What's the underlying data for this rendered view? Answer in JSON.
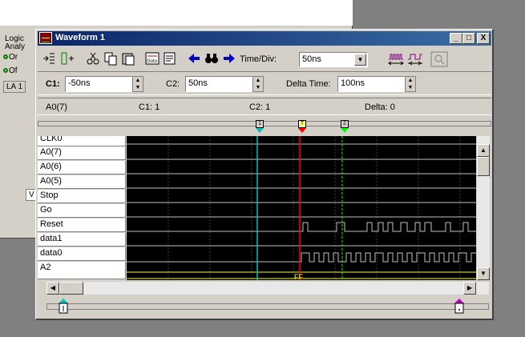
{
  "background_window": {
    "labels": [
      "Logic",
      "Analy"
    ],
    "radio1": "Or",
    "radio2": "Of",
    "box_label": "LA 1",
    "side_box": "V"
  },
  "window": {
    "title": "Waveform 1",
    "buttons": {
      "minimize": "_",
      "maximize": "□",
      "close": "X"
    }
  },
  "toolbar": {
    "time_div_label": "Time/Div:",
    "time_div_value": "50ns",
    "goto_label": "Goto"
  },
  "cursors": {
    "c1_label": "C1:",
    "c1_value": "-50ns",
    "c2_label": "C2:",
    "c2_value": "50ns",
    "delta_label": "Delta Time:",
    "delta_value": "100ns"
  },
  "info": {
    "signal": "A0(7)",
    "c1": "C1: 1",
    "c2": "C2: 1",
    "delta": "Delta: 0"
  },
  "markers": {
    "m1": "1",
    "t": "T",
    "m2": "2"
  },
  "signals": [
    "CLK0",
    "A0(7)",
    "A0(6)",
    "A0(5)",
    "Stop",
    "Go",
    "Reset",
    "data1",
    "data0",
    "A2"
  ],
  "bus_value": "FF",
  "colors": {
    "cursor1": "#00c0c0",
    "trigger": "#ff0000",
    "cursor2": "#00ff00",
    "trace": "#ffffff",
    "grid": "#404040",
    "bus": "#ffff00"
  }
}
